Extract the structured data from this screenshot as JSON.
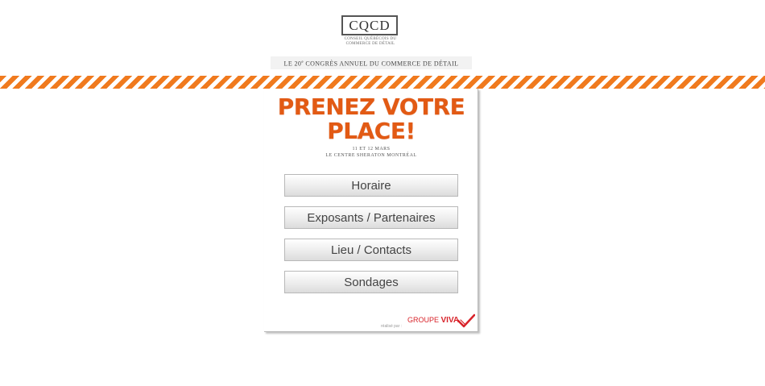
{
  "header": {
    "logo_letters": "CQCD",
    "logo_subtitle": "CONSEIL QUÉBÉCOIS DU COMMERCE DE DÉTAIL",
    "congress_prefix": "LE 20",
    "congress_sup": "e",
    "congress_suffix": " CONGRÈS ANNUEL DU COMMERCE DE DÉTAIL"
  },
  "colors": {
    "stripe": "#f07a1e",
    "headline": "#e25a14",
    "brand": "#d8232a"
  },
  "panel": {
    "headline_line1": "PRENEZ VOTRE",
    "headline_line2": "PLACE!",
    "date": "11 ET 12 MARS",
    "venue": "LE CENTRE SHERATON MONTRÉAL",
    "menu": [
      {
        "label": "Horaire"
      },
      {
        "label": "Exposants / Partenaires"
      },
      {
        "label": "Lieu / Contacts"
      },
      {
        "label": "Sondages"
      }
    ],
    "powered_by": "réalisé par :",
    "brand_prefix": "GROUPE ",
    "brand_name": "VIVA",
    "brand_icon": "checkmark-icon"
  }
}
